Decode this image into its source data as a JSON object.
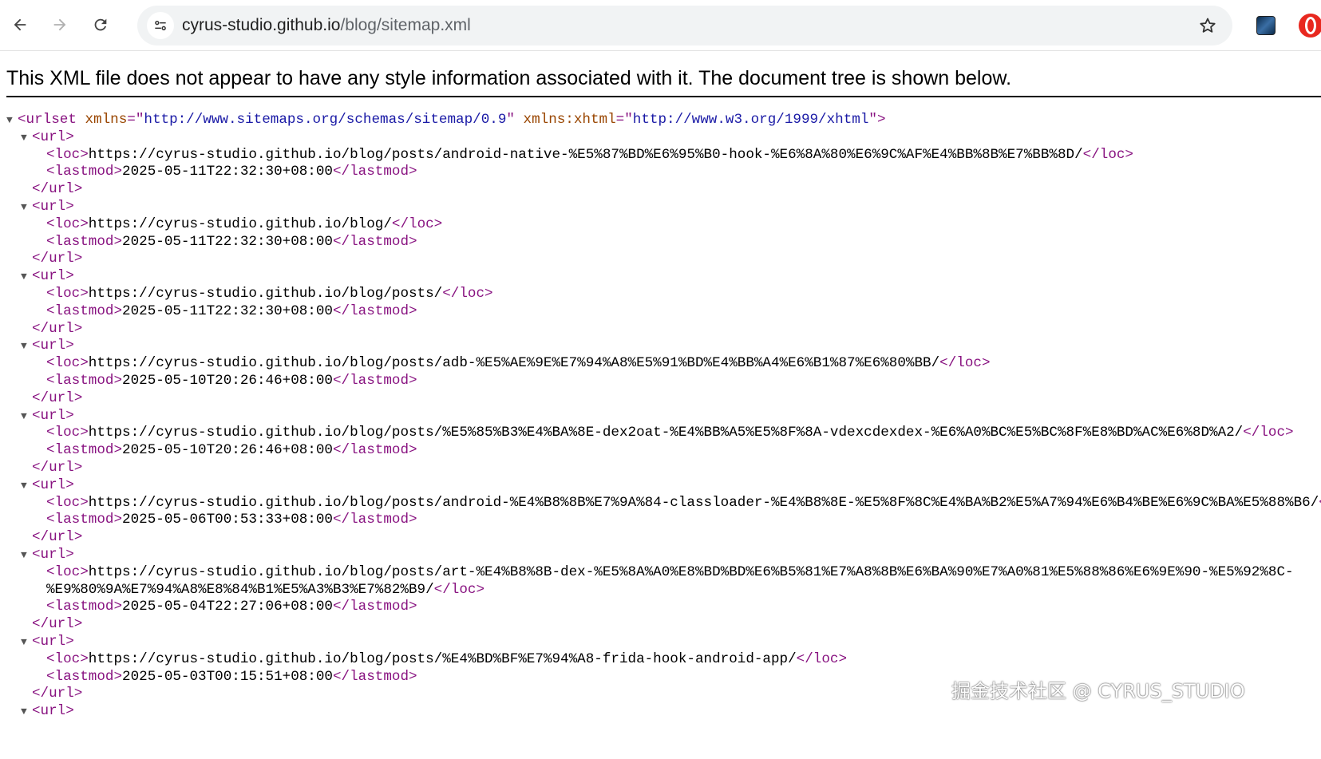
{
  "browser": {
    "url_host": "cyrus-studio.github.io",
    "url_path": "/blog/sitemap.xml"
  },
  "viewer": {
    "notice": "This XML file does not appear to have any style information associated with it. The document tree is shown below.",
    "root_tag": "urlset",
    "root_attrs": [
      {
        "name": "xmlns",
        "value": "http://www.sitemaps.org/schemas/sitemap/0.9"
      },
      {
        "name": "xmlns:xhtml",
        "value": "http://www.w3.org/1999/xhtml"
      }
    ],
    "entries": [
      {
        "loc": [
          "https://cyrus-studio.github.io/blog/posts/android-native-%E5%87%BD%E6%95%B0-hook-%E6%8A%80%E6%9C%AF%E4%BB%8B%E7%BB%8D/"
        ],
        "lastmod": "2025-05-11T22:32:30+08:00"
      },
      {
        "loc": [
          "https://cyrus-studio.github.io/blog/"
        ],
        "lastmod": "2025-05-11T22:32:30+08:00"
      },
      {
        "loc": [
          "https://cyrus-studio.github.io/blog/posts/"
        ],
        "lastmod": "2025-05-11T22:32:30+08:00"
      },
      {
        "loc": [
          "https://cyrus-studio.github.io/blog/posts/adb-%E5%AE%9E%E7%94%A8%E5%91%BD%E4%BB%A4%E6%B1%87%E6%80%BB/"
        ],
        "lastmod": "2025-05-10T20:26:46+08:00"
      },
      {
        "loc": [
          "https://cyrus-studio.github.io/blog/posts/%E5%85%B3%E4%BA%8E-dex2oat-%E4%BB%A5%E5%8F%8A-vdexcdexdex-%E6%A0%BC%E5%BC%8F%E8%BD%AC%E6%8D%A2/"
        ],
        "lastmod": "2025-05-10T20:26:46+08:00"
      },
      {
        "loc": [
          "https://cyrus-studio.github.io/blog/posts/android-%E4%B8%8B%E7%9A%84-classloader-%E4%B8%8E-%E5%8F%8C%E4%BA%B2%E5%A7%94%E6%B4%BE%E6%9C%BA%E5%88%B6/"
        ],
        "lastmod": "2025-05-06T00:53:33+08:00"
      },
      {
        "loc": [
          "https://cyrus-studio.github.io/blog/posts/art-%E4%B8%8B-dex-%E5%8A%A0%E8%BD%BD%E6%B5%81%E7%A8%8B%E6%BA%90%E7%A0%81%E5%88%86%E6%9E%90-%E5%92%8C-",
          "%E9%80%9A%E7%94%A8%E8%84%B1%E5%A3%B3%E7%82%B9/"
        ],
        "lastmod": "2025-05-04T22:27:06+08:00"
      },
      {
        "loc": [
          "https://cyrus-studio.github.io/blog/posts/%E4%BD%BF%E7%94%A8-frida-hook-android-app/"
        ],
        "lastmod": "2025-05-03T00:15:51+08:00"
      }
    ],
    "trailing_tag": "url"
  },
  "watermark": "掘金技术社区 @ CYRUS_STUDIO"
}
